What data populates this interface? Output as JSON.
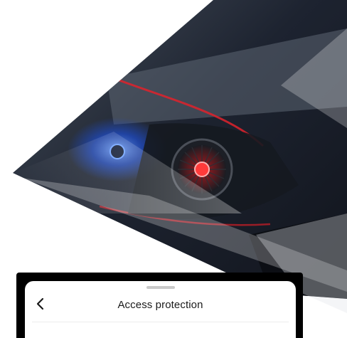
{
  "sheet": {
    "title": "Access protection"
  },
  "icons": {
    "back": "chevron-left-icon"
  },
  "colors": {
    "frame": "#000000",
    "sheet_background": "#ffffff",
    "accent_red": "#e0222c",
    "accent_blue": "#2f6cff"
  }
}
